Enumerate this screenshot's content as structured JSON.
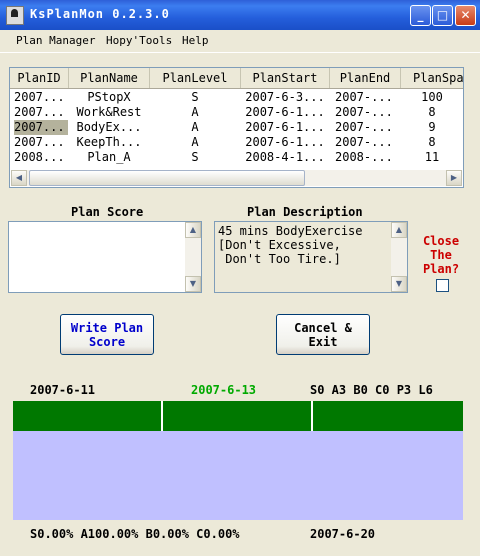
{
  "window": {
    "title": "KsPlanMon 0.2.3.0",
    "min": "_",
    "max": "□",
    "close": "✕"
  },
  "menu": [
    "Plan Manager",
    "Hopy'Tools",
    "Help"
  ],
  "list": {
    "columns": [
      "PlanID",
      "PlanName",
      "PlanLevel",
      "PlanStart",
      "PlanEnd",
      "PlanSpa"
    ],
    "rows": [
      [
        "2007...",
        "PStopX",
        "S",
        "2007-6-3...",
        "2007-...",
        "100"
      ],
      [
        "2007...",
        "Work&Rest",
        "A",
        "2007-6-1...",
        "2007-...",
        "8"
      ],
      [
        "2007...",
        "BodyEx...",
        "A",
        "2007-6-1...",
        "2007-...",
        "9"
      ],
      [
        "2007...",
        "KeepTh...",
        "A",
        "2007-6-1...",
        "2007-...",
        "8"
      ],
      [
        "2008...",
        "Plan_A",
        "S",
        "2008-4-1...",
        "2008-...",
        "11"
      ]
    ],
    "selected_row": 2
  },
  "score": {
    "label": "Plan Score",
    "value": ""
  },
  "description": {
    "label": "Plan Description",
    "value": "45 mins BodyExercise\n[Don't Excessive,\n Don't Too Tire.]"
  },
  "close_plan": {
    "label": "Close The Plan?",
    "line1": "Close",
    "line2": "The",
    "line3": "Plan?",
    "checked": false
  },
  "buttons": {
    "write_score": "Write Plan\nScore",
    "cancel_exit": "Cancel &\nExit"
  },
  "timeline": {
    "start_date": "2007-6-11",
    "current_date": "2007-6-13",
    "counts": "S0 A3 B0 C0 P3 L6",
    "percentages": "S0.00% A100.00% B0.00% C0.00%",
    "end_date": "2007-6-20",
    "current_color": "#00AA00",
    "bar_color": "#007800",
    "area_color": "#C0C0FF"
  }
}
